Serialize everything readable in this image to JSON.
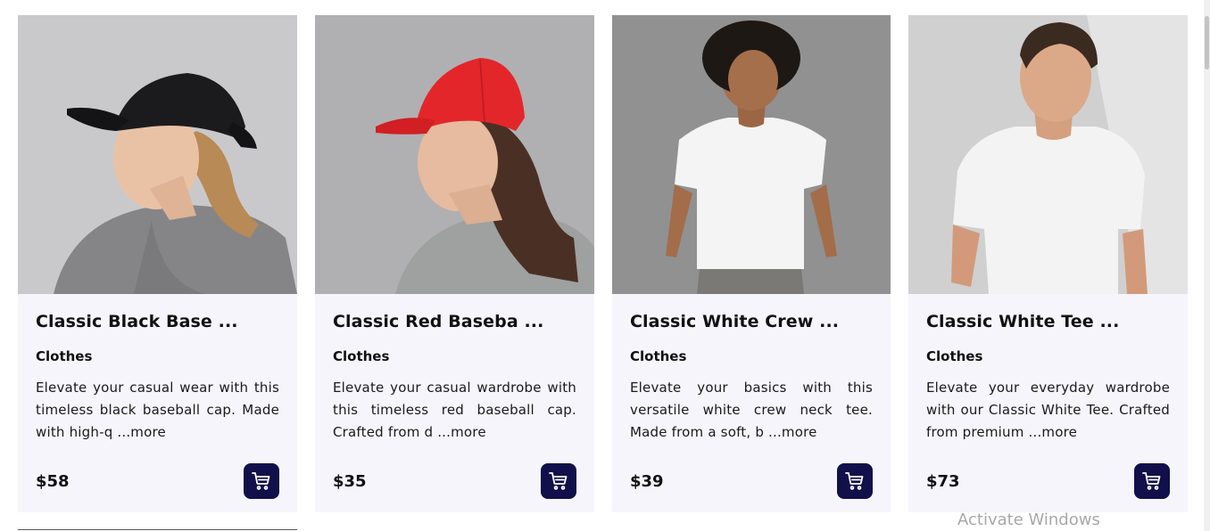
{
  "accent_color": "#12104a",
  "products": [
    {
      "title": "Classic Black Base ...",
      "category": "Clothes",
      "description": "Elevate your casual wear with this timeless black baseball cap. Made with high-q",
      "more": "...more",
      "price": "$58",
      "cart_icon": "shopping-cart-icon"
    },
    {
      "title": "Classic Red Baseba ...",
      "category": "Clothes",
      "description": "Elevate your casual wardrobe with this timeless red baseball cap. Crafted from d",
      "more": "...more",
      "price": "$35",
      "cart_icon": "shopping-cart-icon"
    },
    {
      "title": "Classic White Crew ...",
      "category": "Clothes",
      "description": "Elevate your basics with this versatile white crew neck tee. Made from a soft, b",
      "more": "...more",
      "price": "$39",
      "cart_icon": "shopping-cart-icon"
    },
    {
      "title": "Classic White Tee ...",
      "category": "Clothes",
      "description": "Elevate your everyday wardrobe with our Classic White Tee. Crafted from premium",
      "more": "...more",
      "price": "$73",
      "cart_icon": "shopping-cart-icon"
    }
  ],
  "watermark": "Activate Windows"
}
